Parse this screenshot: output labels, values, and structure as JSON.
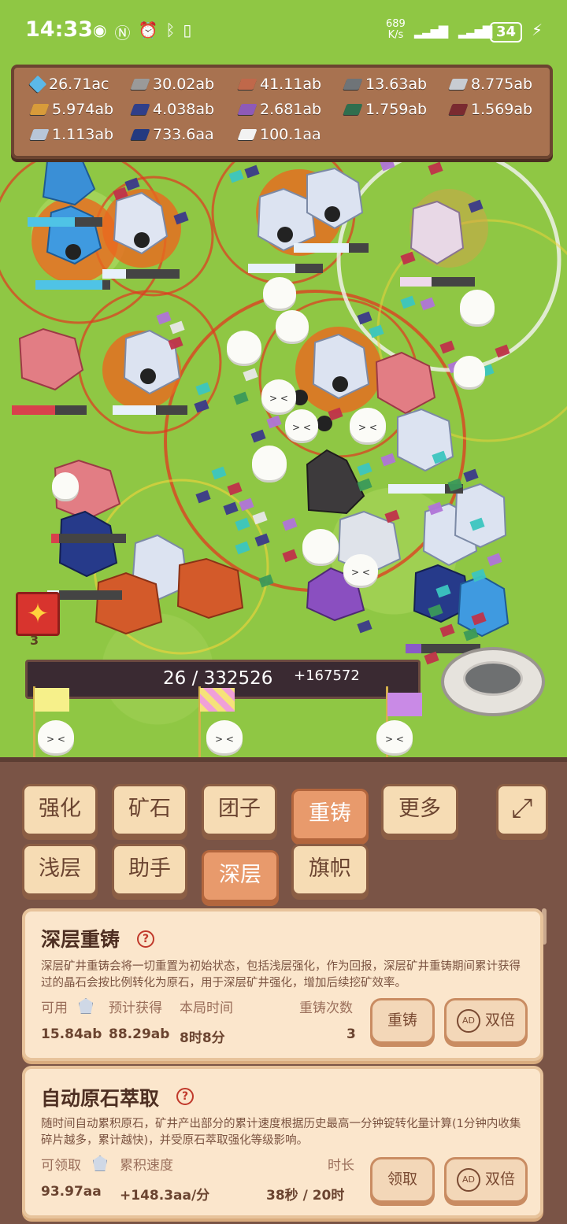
{
  "status_bar": {
    "time": "14:33",
    "net_rate": "689",
    "net_unit": "K/s",
    "battery": "34"
  },
  "resources": [
    {
      "value": "26.71ac",
      "icon": "blue-diamond-icon",
      "color": "#5bb8e8"
    },
    {
      "value": "30.02ab",
      "icon": "iron-ingot-icon",
      "color": "#9a9a9a"
    },
    {
      "value": "41.11ab",
      "icon": "copper-ingot-icon",
      "color": "#c0684a"
    },
    {
      "value": "13.63ab",
      "icon": "steel-ingot-icon",
      "color": "#6f7478"
    },
    {
      "value": "8.775ab",
      "icon": "silver-ingot-icon",
      "color": "#c8ccd2"
    },
    {
      "value": "5.974ab",
      "icon": "gold-ingot-icon",
      "color": "#d89b3a"
    },
    {
      "value": "4.038ab",
      "icon": "sapphire-ingot-icon",
      "color": "#2f3f8a"
    },
    {
      "value": "2.681ab",
      "icon": "amethyst-ingot-icon",
      "color": "#8e5ab8"
    },
    {
      "value": "1.759ab",
      "icon": "emerald-ingot-icon",
      "color": "#2f6e4e"
    },
    {
      "value": "1.569ab",
      "icon": "ruby-ingot-icon",
      "color": "#7a2a30"
    },
    {
      "value": "1.113ab",
      "icon": "crystal-ingot-icon",
      "color": "#b8c6d8"
    },
    {
      "value": "733.6aa",
      "icon": "cobalt-ingot-icon",
      "color": "#243a80"
    },
    {
      "value": "100.1aa",
      "icon": "white-ingot-icon",
      "color": "#f2f2f2"
    }
  ],
  "progress": {
    "text": "26 / 332526",
    "gain": "+167572"
  },
  "gift_count": "3",
  "tabs_row1": [
    "强化",
    "矿石",
    "团子",
    "重铸",
    "更多"
  ],
  "tabs_row2": [
    "浅层",
    "助手",
    "深层",
    "旗帜"
  ],
  "active_tab_row1": "重铸",
  "active_tab_row2": "深层",
  "card_recast": {
    "title": "深层重铸",
    "help": "?",
    "description": "深层矿井重铸会将一切重置为初始状态，包括浅层强化，作为回报，深层矿井重铸期间累计获得过的晶石会按比例转化为原石，用于深层矿井强化，增加后续挖矿效率。",
    "labels": {
      "available": "可用",
      "expected": "预计获得",
      "run_time": "本局时间",
      "count": "重铸次数"
    },
    "values": {
      "available": "15.84ab",
      "expected": "88.29ab",
      "run_time": "8时8分",
      "count": "3"
    },
    "button": "重铸",
    "double_button": "双倍",
    "ad_badge": "AD"
  },
  "card_extract": {
    "title": "自动原石萃取",
    "help": "?",
    "description": "随时间自动累积原石，矿井产出部分的累计速度根据历史最高一分钟锭转化量计算(1分钟内收集碎片越多，累计越快)，并受原石萃取强化等级影响。",
    "labels": {
      "claimable": "可领取",
      "rate": "累积速度",
      "duration": "时长"
    },
    "values": {
      "claimable": "93.97aa",
      "rate": "+148.3aa/分",
      "duration": "38秒 / 20时"
    },
    "button": "领取",
    "double_button": "双倍",
    "ad_badge": "AD"
  }
}
